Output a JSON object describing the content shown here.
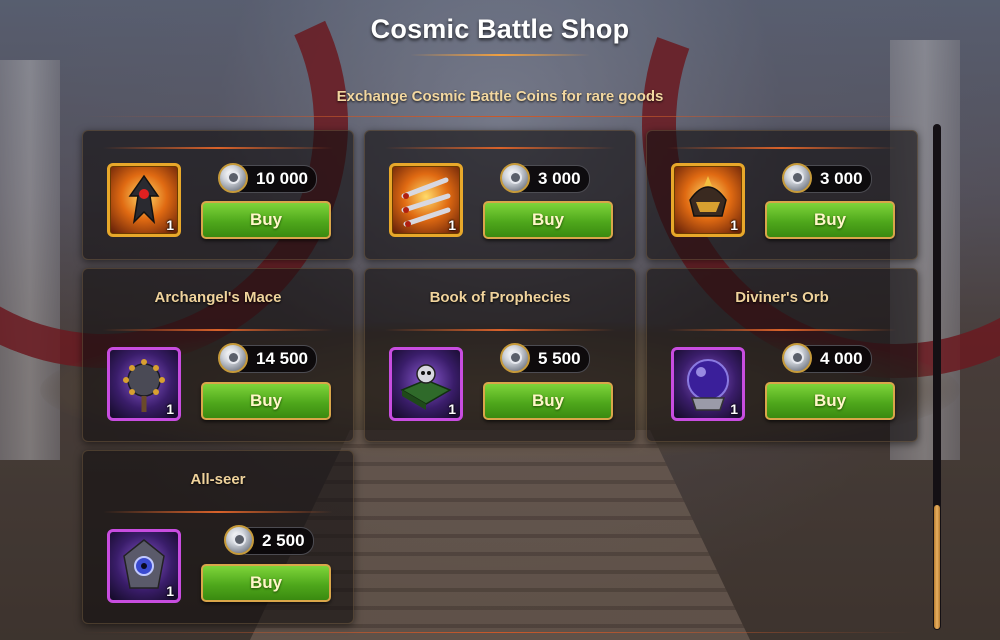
{
  "shop": {
    "title": "Cosmic Battle Shop",
    "subtitle": "Exchange Cosmic Battle Coins for rare goods"
  },
  "currency_icon": "cosmic-battle-coin-icon",
  "colors": {
    "buy_green": "#4fa81c",
    "gold_frame": "#e8a82a",
    "purple_frame": "#c84de0",
    "accent_orange": "#d9622a"
  },
  "items": [
    {
      "name": "",
      "icon": "spiked-weapon-icon",
      "frame": "gold",
      "qty": "1",
      "price": "10 000",
      "buy_label": "Buy"
    },
    {
      "name": "",
      "icon": "throwing-daggers-icon",
      "frame": "gold",
      "qty": "1",
      "price": "3 000",
      "buy_label": "Buy"
    },
    {
      "name": "",
      "icon": "samurai-helmet-icon",
      "frame": "gold",
      "qty": "1",
      "price": "3 000",
      "buy_label": "Buy"
    },
    {
      "name": "Archangel's Mace",
      "icon": "spiked-mace-icon",
      "frame": "purple",
      "qty": "1",
      "price": "14 500",
      "buy_label": "Buy"
    },
    {
      "name": "Book of Prophecies",
      "icon": "spellbook-icon",
      "frame": "purple",
      "qty": "1",
      "price": "5 500",
      "buy_label": "Buy"
    },
    {
      "name": "Diviner's Orb",
      "icon": "crystal-orb-icon",
      "frame": "purple",
      "qty": "1",
      "price": "4 000",
      "buy_label": "Buy"
    },
    {
      "name": "All-seer",
      "icon": "all-seer-amulet-icon",
      "frame": "purple",
      "qty": "1",
      "price": "2 500",
      "buy_label": "Buy"
    }
  ]
}
